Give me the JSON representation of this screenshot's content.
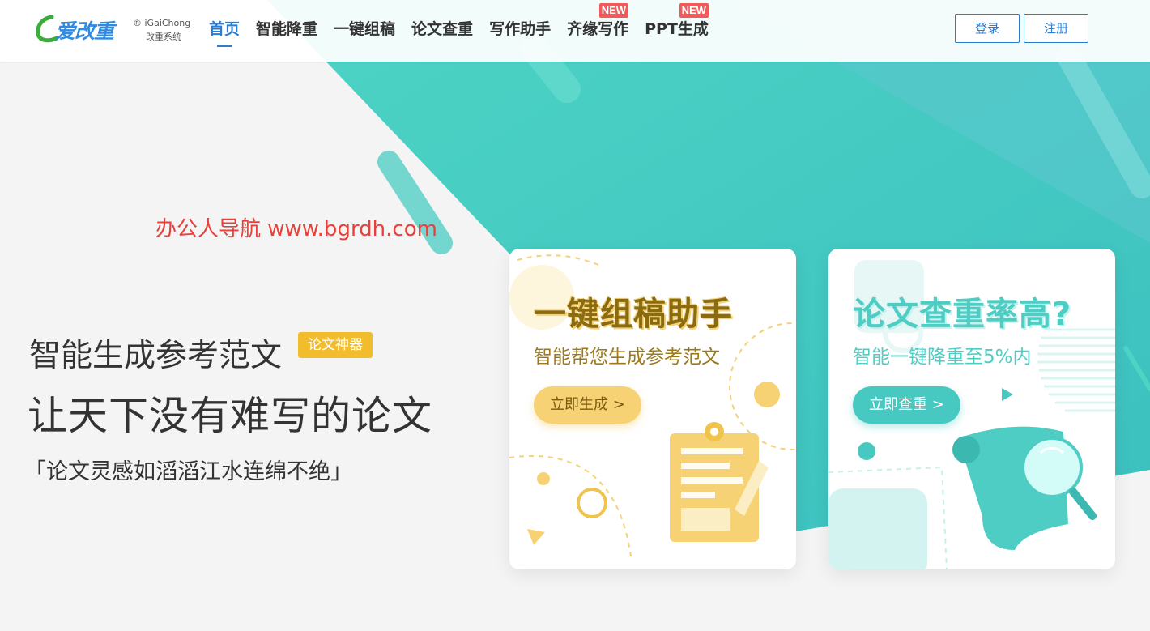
{
  "header": {
    "logo": {
      "text": "爱改重",
      "sub1": "® iGaiChong",
      "sub2": "改重系统"
    },
    "nav": [
      {
        "label": "首页",
        "active": true,
        "badge": ""
      },
      {
        "label": "智能降重",
        "active": false,
        "badge": ""
      },
      {
        "label": "一键组稿",
        "active": false,
        "badge": ""
      },
      {
        "label": "论文查重",
        "active": false,
        "badge": ""
      },
      {
        "label": "写作助手",
        "active": false,
        "badge": ""
      },
      {
        "label": "齐缘写作",
        "active": false,
        "badge": "NEW"
      },
      {
        "label": "PPT生成",
        "active": false,
        "badge": "NEW"
      }
    ],
    "login_label": "登录",
    "register_label": "注册"
  },
  "watermark": "办公人导航  www.bgrdh.com",
  "hero": {
    "line1": "智能生成参考范文",
    "tag": "论文神器",
    "line2": "让天下没有难写的论文",
    "line3": "「论文灵感如滔滔江水连绵不绝」"
  },
  "cards": [
    {
      "title": "一键组稿助手",
      "subtitle": "智能帮您生成参考范文",
      "button": "立即生成 >"
    },
    {
      "title": "论文查重率高?",
      "subtitle": "智能一键降重至5%内",
      "button": "立即查重 >"
    }
  ],
  "colors": {
    "primary": "#2b7cd3",
    "teal": "#4ecdc4",
    "gold": "#f7d274",
    "badge": "#f05a5a",
    "tag": "#f2bd2c"
  }
}
